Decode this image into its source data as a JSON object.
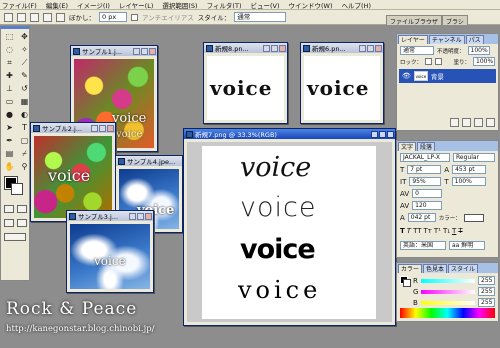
{
  "menu": [
    "ファイル(F)",
    "編集(E)",
    "イメージ(I)",
    "レイヤー(L)",
    "選択範囲(S)",
    "フィルタ(T)",
    "ビュー(V)",
    "ウインドウ(W)",
    "ヘルプ(H)"
  ],
  "options": {
    "feather_label": "ぼかし：",
    "feather_value": "0 px",
    "antialias_label": "アンチエイリアス",
    "style_label": "スタイル：",
    "style_value": "通常"
  },
  "palette_well": [
    "ファイルブラウザ",
    "ブラシ"
  ],
  "windows": {
    "sample1": {
      "title": "サンプル1.j...",
      "photo_text": "voice",
      "photo_text2": "voice"
    },
    "sample2": {
      "title": "サンプル2.j...",
      "photo_text": "voice"
    },
    "sample4": {
      "title": "サンプル4.jpe...",
      "photo_text": "voice"
    },
    "sample3": {
      "title": "サンプル3.j...",
      "photo_text": "voice"
    },
    "new8": {
      "title": "新規8.pn...",
      "word": "voice"
    },
    "new6": {
      "title": "新規6.pn...",
      "word": "voice"
    },
    "new7": {
      "title": "新規7.png @ 33.3%(RGB)",
      "words": [
        "voice",
        "voice",
        "voice",
        "voice"
      ]
    }
  },
  "layers_panel": {
    "tabs": [
      "レイヤー",
      "チャンネル",
      "パス"
    ],
    "blend": "通常",
    "opacity_label": "不透明度：",
    "opacity": "100%",
    "lock_label": "ロック：",
    "fill_label": "塗り：",
    "fill": "100%",
    "layer_name": "背景",
    "layer_thumb": "voice"
  },
  "character_panel": {
    "tabs": [
      "文字",
      "段落"
    ],
    "font": "JACKAL_LP-X",
    "font_style": "Regular",
    "size": "7 pt",
    "leading": "453 pt",
    "vscale": "95%",
    "hscale": "100%",
    "kerning": "0",
    "tracking": "120",
    "baseline": "042 pt",
    "color_label": "カラー：",
    "language": "英語：米国",
    "antialias": "aa 鮮明"
  },
  "color_panel": {
    "tabs": [
      "カラー",
      "色見本",
      "スタイル"
    ],
    "channels": [
      {
        "name": "R",
        "value": "255"
      },
      {
        "name": "G",
        "value": "255"
      },
      {
        "name": "B",
        "value": "255"
      }
    ]
  },
  "watermark": {
    "title": "Rock & Peace",
    "url": "http://kanegonstar.blog.chinobi.jp/"
  },
  "colors": {
    "title_active": "#1947b8",
    "workspace": "#8d8d8d",
    "layer_select": "#2752b6"
  }
}
